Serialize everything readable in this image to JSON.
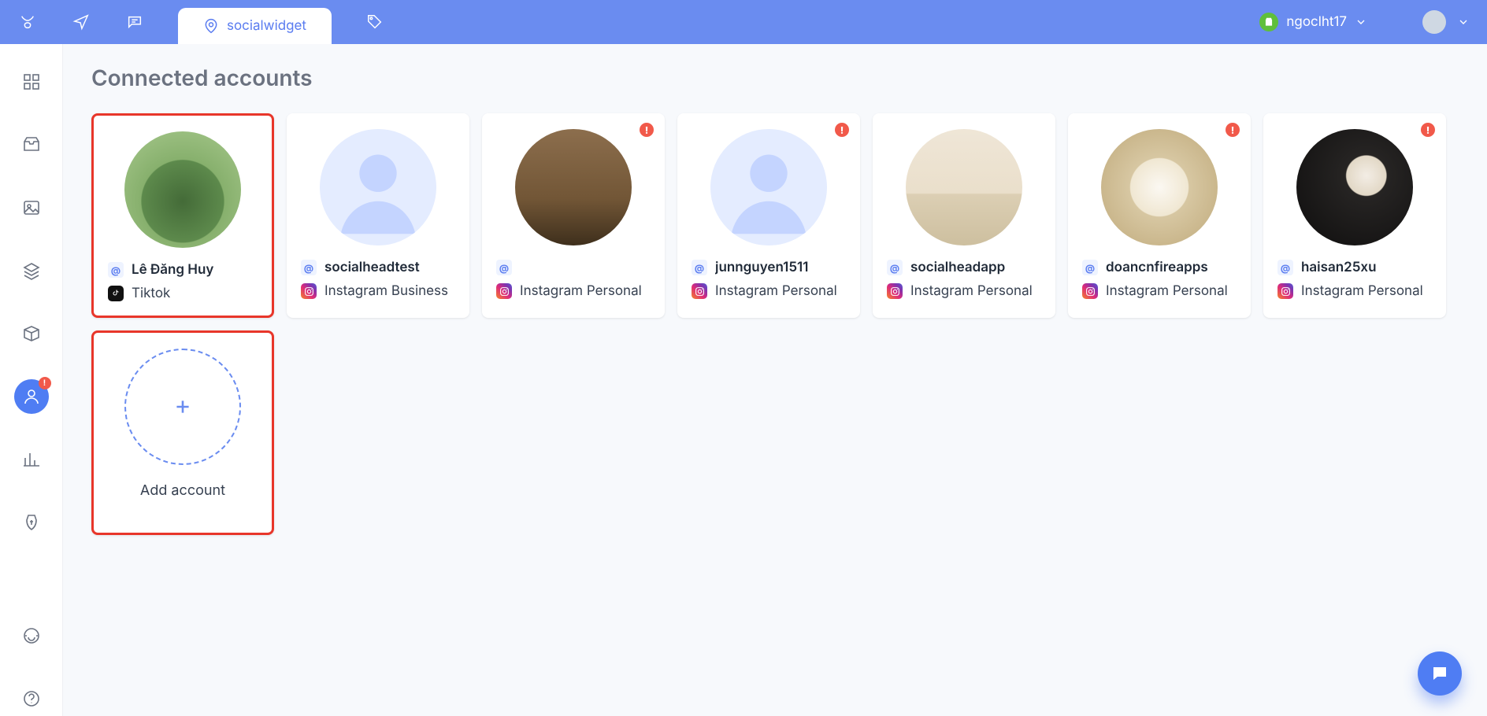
{
  "topbar": {
    "active_tab_label": "socialwidget",
    "username": "ngoclht17"
  },
  "page": {
    "title": "Connected accounts",
    "add_account_label": "Add account"
  },
  "platform_labels": {
    "tiktok": "Tiktok",
    "instagram_business": "Instagram Business",
    "instagram_personal": "Instagram Personal"
  },
  "accounts": [
    {
      "username": "Lê Đăng Huy",
      "platform": "tiktok",
      "warn": false,
      "highlight": true,
      "avatar": "photo",
      "avatar_style": "ph-garden"
    },
    {
      "username": "socialheadtest",
      "platform": "instagram_business",
      "warn": false,
      "highlight": false,
      "avatar": "placeholder"
    },
    {
      "username": "",
      "platform": "instagram_personal",
      "warn": true,
      "highlight": false,
      "avatar": "photo",
      "avatar_style": "ph-room"
    },
    {
      "username": "junnguyen1511",
      "platform": "instagram_personal",
      "warn": true,
      "highlight": false,
      "avatar": "placeholder"
    },
    {
      "username": "socialheadapp",
      "platform": "instagram_personal",
      "warn": false,
      "highlight": false,
      "avatar": "photo",
      "avatar_style": "ph-kitchen"
    },
    {
      "username": "doancnfireapps",
      "platform": "instagram_personal",
      "warn": true,
      "highlight": false,
      "avatar": "photo",
      "avatar_style": "ph-flowers"
    },
    {
      "username": "haisan25xu",
      "platform": "instagram_personal",
      "warn": true,
      "highlight": false,
      "avatar": "photo",
      "avatar_style": "ph-coffee"
    }
  ]
}
